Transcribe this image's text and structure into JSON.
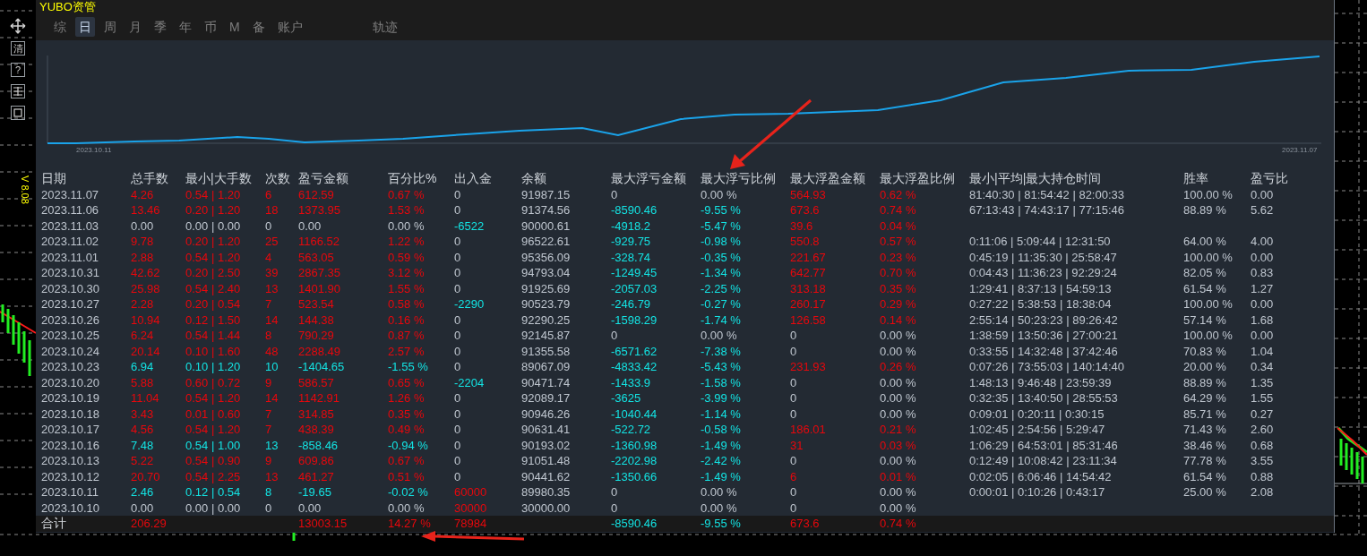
{
  "window": {
    "title": "YUBO资管"
  },
  "toolbar": [
    {
      "kind": "move"
    },
    {
      "kind": "label",
      "text": "清"
    },
    {
      "kind": "label",
      "text": "?"
    },
    {
      "kind": "grid"
    },
    {
      "kind": "frame"
    }
  ],
  "version": "V 8.08",
  "tab_groups": [
    {
      "tabs": [
        {
          "label": "综",
          "selected": false
        },
        {
          "label": "日",
          "selected": true
        },
        {
          "label": "周",
          "selected": false
        },
        {
          "label": "月",
          "selected": false
        },
        {
          "label": "季",
          "selected": false
        },
        {
          "label": "年",
          "selected": false
        },
        {
          "label": "币",
          "selected": false
        },
        {
          "label": "M",
          "selected": false
        },
        {
          "label": "备",
          "selected": false
        },
        {
          "label": "账户",
          "selected": false
        }
      ]
    },
    {
      "tabs": [
        {
          "label": "轨迹",
          "selected": false
        }
      ]
    }
  ],
  "chart": {
    "start_label": "2023.10.11",
    "end_label": "2023.11.07"
  },
  "table": {
    "columns": [
      "日期",
      "总手数",
      "最小|大手数",
      "次数",
      "盈亏金额",
      "百分比%",
      "出入金",
      "余额",
      "最大浮亏金额",
      "最大浮亏比例",
      "最大浮盈金额",
      "最大浮盈比例",
      "最小|平均|最大持仓时间",
      "胜率",
      "盈亏比"
    ],
    "rows": [
      {
        "date": "2023.11.07",
        "lots": {
          "text": "4.26",
          "color": "#e8070c"
        },
        "lot_range": {
          "text": "0.54 | 1.20",
          "color": "#e8070c"
        },
        "trades": {
          "text": "6",
          "color": "#e8070c"
        },
        "pnl": {
          "text": "612.59",
          "color": "#e8070c"
        },
        "percent": {
          "text": "0.67 %",
          "color": "#e8070c"
        },
        "flow": {
          "text": "0",
          "color": "#bfc6cf"
        },
        "balance": "91987.15",
        "max_float_loss": {
          "text": "0",
          "color": "#bfc6cf"
        },
        "max_float_loss_pct": {
          "text": "0.00 %",
          "color": "#bfc6cf"
        },
        "max_float_profit": {
          "text": "564.93",
          "color": "#e8070c"
        },
        "max_float_profit_pct": {
          "text": "0.62 %",
          "color": "#e8070c"
        },
        "hold_times": "81:40:30 | 81:54:42 | 82:00:33",
        "win_rate": "100.00 %",
        "pl_ratio": "0.00"
      },
      {
        "date": "2023.11.06",
        "lots": {
          "text": "13.46",
          "color": "#e8070c"
        },
        "lot_range": {
          "text": "0.20 | 1.20",
          "color": "#e8070c"
        },
        "trades": {
          "text": "18",
          "color": "#e8070c"
        },
        "pnl": {
          "text": "1373.95",
          "color": "#e8070c"
        },
        "percent": {
          "text": "1.53 %",
          "color": "#e8070c"
        },
        "flow": {
          "text": "0",
          "color": "#bfc6cf"
        },
        "balance": "91374.56",
        "max_float_loss": {
          "text": "-8590.46",
          "color": "#13e3e3"
        },
        "max_float_loss_pct": {
          "text": "-9.55 %",
          "color": "#13e3e3"
        },
        "max_float_profit": {
          "text": "673.6",
          "color": "#e8070c"
        },
        "max_float_profit_pct": {
          "text": "0.74 %",
          "color": "#e8070c"
        },
        "hold_times": "67:13:43 | 74:43:17 | 77:15:46",
        "win_rate": "88.89 %",
        "pl_ratio": "5.62"
      },
      {
        "date": "2023.11.03",
        "lots": {
          "text": "0.00",
          "color": "#bfc6cf"
        },
        "lot_range": {
          "text": "0.00 | 0.00",
          "color": "#bfc6cf"
        },
        "trades": {
          "text": "0",
          "color": "#bfc6cf"
        },
        "pnl": {
          "text": "0.00",
          "color": "#bfc6cf"
        },
        "percent": {
          "text": "0.00 %",
          "color": "#bfc6cf"
        },
        "flow": {
          "text": "-6522",
          "color": "#13e3e3"
        },
        "balance": "90000.61",
        "max_float_loss": {
          "text": "-4918.2",
          "color": "#13e3e3"
        },
        "max_float_loss_pct": {
          "text": "-5.47 %",
          "color": "#13e3e3"
        },
        "max_float_profit": {
          "text": "39.6",
          "color": "#e8070c"
        },
        "max_float_profit_pct": {
          "text": "0.04 %",
          "color": "#e8070c"
        }
      },
      {
        "date": "2023.11.02",
        "lots": {
          "text": "9.78",
          "color": "#e8070c"
        },
        "lot_range": {
          "text": "0.20 | 1.20",
          "color": "#e8070c"
        },
        "trades": {
          "text": "25",
          "color": "#e8070c"
        },
        "pnl": {
          "text": "1166.52",
          "color": "#e8070c"
        },
        "percent": {
          "text": "1.22 %",
          "color": "#e8070c"
        },
        "flow": {
          "text": "0",
          "color": "#bfc6cf"
        },
        "balance": "96522.61",
        "max_float_loss": {
          "text": "-929.75",
          "color": "#13e3e3"
        },
        "max_float_loss_pct": {
          "text": "-0.98 %",
          "color": "#13e3e3"
        },
        "max_float_profit": {
          "text": "550.8",
          "color": "#e8070c"
        },
        "max_float_profit_pct": {
          "text": "0.57 %",
          "color": "#e8070c"
        },
        "hold_times": "0:11:06 | 5:09:44 | 12:31:50",
        "win_rate": "64.00 %",
        "pl_ratio": "4.00"
      },
      {
        "date": "2023.11.01",
        "lots": {
          "text": "2.88",
          "color": "#e8070c"
        },
        "lot_range": {
          "text": "0.54 | 1.20",
          "color": "#e8070c"
        },
        "trades": {
          "text": "4",
          "color": "#e8070c"
        },
        "pnl": {
          "text": "563.05",
          "color": "#e8070c"
        },
        "percent": {
          "text": "0.59 %",
          "color": "#e8070c"
        },
        "flow": {
          "text": "0",
          "color": "#bfc6cf"
        },
        "balance": "95356.09",
        "max_float_loss": {
          "text": "-328.74",
          "color": "#13e3e3"
        },
        "max_float_loss_pct": {
          "text": "-0.35 %",
          "color": "#13e3e3"
        },
        "max_float_profit": {
          "text": "221.67",
          "color": "#e8070c"
        },
        "max_float_profit_pct": {
          "text": "0.23 %",
          "color": "#e8070c"
        },
        "hold_times": "0:45:19 | 11:35:30 | 25:58:47",
        "win_rate": "100.00 %",
        "pl_ratio": "0.00"
      },
      {
        "date": "2023.10.31",
        "lots": {
          "text": "42.62",
          "color": "#e8070c"
        },
        "lot_range": {
          "text": "0.20 | 2.50",
          "color": "#e8070c"
        },
        "trades": {
          "text": "39",
          "color": "#e8070c"
        },
        "pnl": {
          "text": "2867.35",
          "color": "#e8070c"
        },
        "percent": {
          "text": "3.12 %",
          "color": "#e8070c"
        },
        "flow": {
          "text": "0",
          "color": "#bfc6cf"
        },
        "balance": "94793.04",
        "max_float_loss": {
          "text": "-1249.45",
          "color": "#13e3e3"
        },
        "max_float_loss_pct": {
          "text": "-1.34 %",
          "color": "#13e3e3"
        },
        "max_float_profit": {
          "text": "642.77",
          "color": "#e8070c"
        },
        "max_float_profit_pct": {
          "text": "0.70 %",
          "color": "#e8070c"
        },
        "hold_times": "0:04:43 | 11:36:23 | 92:29:24",
        "win_rate": "82.05 %",
        "pl_ratio": "0.83"
      },
      {
        "date": "2023.10.30",
        "lots": {
          "text": "25.98",
          "color": "#e8070c"
        },
        "lot_range": {
          "text": "0.54 | 2.40",
          "color": "#e8070c"
        },
        "trades": {
          "text": "13",
          "color": "#e8070c"
        },
        "pnl": {
          "text": "1401.90",
          "color": "#e8070c"
        },
        "percent": {
          "text": "1.55 %",
          "color": "#e8070c"
        },
        "flow": {
          "text": "0",
          "color": "#bfc6cf"
        },
        "balance": "91925.69",
        "max_float_loss": {
          "text": "-2057.03",
          "color": "#13e3e3"
        },
        "max_float_loss_pct": {
          "text": "-2.25 %",
          "color": "#13e3e3"
        },
        "max_float_profit": {
          "text": "313.18",
          "color": "#e8070c"
        },
        "max_float_profit_pct": {
          "text": "0.35 %",
          "color": "#e8070c"
        },
        "hold_times": "1:29:41 | 8:37:13 | 54:59:13",
        "win_rate": "61.54 %",
        "pl_ratio": "1.27"
      },
      {
        "date": "2023.10.27",
        "lots": {
          "text": "2.28",
          "color": "#e8070c"
        },
        "lot_range": {
          "text": "0.20 | 0.54",
          "color": "#e8070c"
        },
        "trades": {
          "text": "7",
          "color": "#e8070c"
        },
        "pnl": {
          "text": "523.54",
          "color": "#e8070c"
        },
        "percent": {
          "text": "0.58 %",
          "color": "#e8070c"
        },
        "flow": {
          "text": "-2290",
          "color": "#13e3e3"
        },
        "balance": "90523.79",
        "max_float_loss": {
          "text": "-246.79",
          "color": "#13e3e3"
        },
        "max_float_loss_pct": {
          "text": "-0.27 %",
          "color": "#13e3e3"
        },
        "max_float_profit": {
          "text": "260.17",
          "color": "#e8070c"
        },
        "max_float_profit_pct": {
          "text": "0.29 %",
          "color": "#e8070c"
        },
        "hold_times": "0:27:22 | 5:38:53 | 18:38:04",
        "win_rate": "100.00 %",
        "pl_ratio": "0.00"
      },
      {
        "date": "2023.10.26",
        "lots": {
          "text": "10.94",
          "color": "#e8070c"
        },
        "lot_range": {
          "text": "0.12 | 1.50",
          "color": "#e8070c"
        },
        "trades": {
          "text": "14",
          "color": "#e8070c"
        },
        "pnl": {
          "text": "144.38",
          "color": "#e8070c"
        },
        "percent": {
          "text": "0.16 %",
          "color": "#e8070c"
        },
        "flow": {
          "text": "0",
          "color": "#bfc6cf"
        },
        "balance": "92290.25",
        "max_float_loss": {
          "text": "-1598.29",
          "color": "#13e3e3"
        },
        "max_float_loss_pct": {
          "text": "-1.74 %",
          "color": "#13e3e3"
        },
        "max_float_profit": {
          "text": "126.58",
          "color": "#e8070c"
        },
        "max_float_profit_pct": {
          "text": "0.14 %",
          "color": "#e8070c"
        },
        "hold_times": "2:55:14 | 50:23:23 | 89:26:42",
        "win_rate": "57.14 %",
        "pl_ratio": "1.68"
      },
      {
        "date": "2023.10.25",
        "lots": {
          "text": "6.24",
          "color": "#e8070c"
        },
        "lot_range": {
          "text": "0.54 | 1.44",
          "color": "#e8070c"
        },
        "trades": {
          "text": "8",
          "color": "#e8070c"
        },
        "pnl": {
          "text": "790.29",
          "color": "#e8070c"
        },
        "percent": {
          "text": "0.87 %",
          "color": "#e8070c"
        },
        "flow": {
          "text": "0",
          "color": "#bfc6cf"
        },
        "balance": "92145.87",
        "max_float_loss": {
          "text": "0",
          "color": "#bfc6cf"
        },
        "max_float_loss_pct": {
          "text": "0.00 %",
          "color": "#bfc6cf"
        },
        "max_float_profit": {
          "text": "0",
          "color": "#bfc6cf"
        },
        "max_float_profit_pct": {
          "text": "0.00 %",
          "color": "#bfc6cf"
        },
        "hold_times": "1:38:59 | 13:50:36 | 27:00:21",
        "win_rate": "100.00 %",
        "pl_ratio": "0.00"
      },
      {
        "date": "2023.10.24",
        "lots": {
          "text": "20.14",
          "color": "#e8070c"
        },
        "lot_range": {
          "text": "0.10 | 1.60",
          "color": "#e8070c"
        },
        "trades": {
          "text": "48",
          "color": "#e8070c"
        },
        "pnl": {
          "text": "2288.49",
          "color": "#e8070c"
        },
        "percent": {
          "text": "2.57 %",
          "color": "#e8070c"
        },
        "flow": {
          "text": "0",
          "color": "#bfc6cf"
        },
        "balance": "91355.58",
        "max_float_loss": {
          "text": "-6571.62",
          "color": "#13e3e3"
        },
        "max_float_loss_pct": {
          "text": "-7.38 %",
          "color": "#13e3e3"
        },
        "max_float_profit": {
          "text": "0",
          "color": "#bfc6cf"
        },
        "max_float_profit_pct": {
          "text": "0.00 %",
          "color": "#bfc6cf"
        },
        "hold_times": "0:33:55 | 14:32:48 | 37:42:46",
        "win_rate": "70.83 %",
        "pl_ratio": "1.04"
      },
      {
        "date": "2023.10.23",
        "lots": {
          "text": "6.94",
          "color": "#13e3e3"
        },
        "lot_range": {
          "text": "0.10 | 1.20",
          "color": "#13e3e3"
        },
        "trades": {
          "text": "10",
          "color": "#13e3e3"
        },
        "pnl": {
          "text": "-1404.65",
          "color": "#13e3e3"
        },
        "percent": {
          "text": "-1.55 %",
          "color": "#13e3e3"
        },
        "flow": {
          "text": "0",
          "color": "#bfc6cf"
        },
        "balance": "89067.09",
        "max_float_loss": {
          "text": "-4833.42",
          "color": "#13e3e3"
        },
        "max_float_loss_pct": {
          "text": "-5.43 %",
          "color": "#13e3e3"
        },
        "max_float_profit": {
          "text": "231.93",
          "color": "#e8070c"
        },
        "max_float_profit_pct": {
          "text": "0.26 %",
          "color": "#e8070c"
        },
        "hold_times": "0:07:26 | 73:55:03 | 140:14:40",
        "win_rate": "20.00 %",
        "pl_ratio": "0.34"
      },
      {
        "date": "2023.10.20",
        "lots": {
          "text": "5.88",
          "color": "#e8070c"
        },
        "lot_range": {
          "text": "0.60 | 0.72",
          "color": "#e8070c"
        },
        "trades": {
          "text": "9",
          "color": "#e8070c"
        },
        "pnl": {
          "text": "586.57",
          "color": "#e8070c"
        },
        "percent": {
          "text": "0.65 %",
          "color": "#e8070c"
        },
        "flow": {
          "text": "-2204",
          "color": "#13e3e3"
        },
        "balance": "90471.74",
        "max_float_loss": {
          "text": "-1433.9",
          "color": "#13e3e3"
        },
        "max_float_loss_pct": {
          "text": "-1.58 %",
          "color": "#13e3e3"
        },
        "max_float_profit": {
          "text": "0",
          "color": "#bfc6cf"
        },
        "max_float_profit_pct": {
          "text": "0.00 %",
          "color": "#bfc6cf"
        },
        "hold_times": "1:48:13 | 9:46:48 | 23:59:39",
        "win_rate": "88.89 %",
        "pl_ratio": "1.35"
      },
      {
        "date": "2023.10.19",
        "lots": {
          "text": "11.04",
          "color": "#e8070c"
        },
        "lot_range": {
          "text": "0.54 | 1.20",
          "color": "#e8070c"
        },
        "trades": {
          "text": "14",
          "color": "#e8070c"
        },
        "pnl": {
          "text": "1142.91",
          "color": "#e8070c"
        },
        "percent": {
          "text": "1.26 %",
          "color": "#e8070c"
        },
        "flow": {
          "text": "0",
          "color": "#bfc6cf"
        },
        "balance": "92089.17",
        "max_float_loss": {
          "text": "-3625",
          "color": "#13e3e3"
        },
        "max_float_loss_pct": {
          "text": "-3.99 %",
          "color": "#13e3e3"
        },
        "max_float_profit": {
          "text": "0",
          "color": "#bfc6cf"
        },
        "max_float_profit_pct": {
          "text": "0.00 %",
          "color": "#bfc6cf"
        },
        "hold_times": "0:32:35 | 13:40:50 | 28:55:53",
        "win_rate": "64.29 %",
        "pl_ratio": "1.55"
      },
      {
        "date": "2023.10.18",
        "lots": {
          "text": "3.43",
          "color": "#e8070c"
        },
        "lot_range": {
          "text": "0.01 | 0.60",
          "color": "#e8070c"
        },
        "trades": {
          "text": "7",
          "color": "#e8070c"
        },
        "pnl": {
          "text": "314.85",
          "color": "#e8070c"
        },
        "percent": {
          "text": "0.35 %",
          "color": "#e8070c"
        },
        "flow": {
          "text": "0",
          "color": "#bfc6cf"
        },
        "balance": "90946.26",
        "max_float_loss": {
          "text": "-1040.44",
          "color": "#13e3e3"
        },
        "max_float_loss_pct": {
          "text": "-1.14 %",
          "color": "#13e3e3"
        },
        "max_float_profit": {
          "text": "0",
          "color": "#bfc6cf"
        },
        "max_float_profit_pct": {
          "text": "0.00 %",
          "color": "#bfc6cf"
        },
        "hold_times": "0:09:01 | 0:20:11 | 0:30:15",
        "win_rate": "85.71 %",
        "pl_ratio": "0.27"
      },
      {
        "date": "2023.10.17",
        "lots": {
          "text": "4.56",
          "color": "#e8070c"
        },
        "lot_range": {
          "text": "0.54 | 1.20",
          "color": "#e8070c"
        },
        "trades": {
          "text": "7",
          "color": "#e8070c"
        },
        "pnl": {
          "text": "438.39",
          "color": "#e8070c"
        },
        "percent": {
          "text": "0.49 %",
          "color": "#e8070c"
        },
        "flow": {
          "text": "0",
          "color": "#bfc6cf"
        },
        "balance": "90631.41",
        "max_float_loss": {
          "text": "-522.72",
          "color": "#13e3e3"
        },
        "max_float_loss_pct": {
          "text": "-0.58 %",
          "color": "#13e3e3"
        },
        "max_float_profit": {
          "text": "186.01",
          "color": "#e8070c"
        },
        "max_float_profit_pct": {
          "text": "0.21 %",
          "color": "#e8070c"
        },
        "hold_times": "1:02:45 | 2:54:56 | 5:29:47",
        "win_rate": "71.43 %",
        "pl_ratio": "2.60"
      },
      {
        "date": "2023.10.16",
        "lots": {
          "text": "7.48",
          "color": "#13e3e3"
        },
        "lot_range": {
          "text": "0.54 | 1.00",
          "color": "#13e3e3"
        },
        "trades": {
          "text": "13",
          "color": "#13e3e3"
        },
        "pnl": {
          "text": "-858.46",
          "color": "#13e3e3"
        },
        "percent": {
          "text": "-0.94 %",
          "color": "#13e3e3"
        },
        "flow": {
          "text": "0",
          "color": "#bfc6cf"
        },
        "balance": "90193.02",
        "max_float_loss": {
          "text": "-1360.98",
          "color": "#13e3e3"
        },
        "max_float_loss_pct": {
          "text": "-1.49 %",
          "color": "#13e3e3"
        },
        "max_float_profit": {
          "text": "31",
          "color": "#e8070c"
        },
        "max_float_profit_pct": {
          "text": "0.03 %",
          "color": "#e8070c"
        },
        "hold_times": "1:06:29 | 64:53:01 | 85:31:46",
        "win_rate": "38.46 %",
        "pl_ratio": "0.68"
      },
      {
        "date": "2023.10.13",
        "lots": {
          "text": "5.22",
          "color": "#e8070c"
        },
        "lot_range": {
          "text": "0.54 | 0.90",
          "color": "#e8070c"
        },
        "trades": {
          "text": "9",
          "color": "#e8070c"
        },
        "pnl": {
          "text": "609.86",
          "color": "#e8070c"
        },
        "percent": {
          "text": "0.67 %",
          "color": "#e8070c"
        },
        "flow": {
          "text": "0",
          "color": "#bfc6cf"
        },
        "balance": "91051.48",
        "max_float_loss": {
          "text": "-2202.98",
          "color": "#13e3e3"
        },
        "max_float_loss_pct": {
          "text": "-2.42 %",
          "color": "#13e3e3"
        },
        "max_float_profit": {
          "text": "0",
          "color": "#bfc6cf"
        },
        "max_float_profit_pct": {
          "text": "0.00 %",
          "color": "#bfc6cf"
        },
        "hold_times": "0:12:49 | 10:08:42 | 23:11:34",
        "win_rate": "77.78 %",
        "pl_ratio": "3.55"
      },
      {
        "date": "2023.10.12",
        "lots": {
          "text": "20.70",
          "color": "#e8070c"
        },
        "lot_range": {
          "text": "0.54 | 2.25",
          "color": "#e8070c"
        },
        "trades": {
          "text": "13",
          "color": "#e8070c"
        },
        "pnl": {
          "text": "461.27",
          "color": "#e8070c"
        },
        "percent": {
          "text": "0.51 %",
          "color": "#e8070c"
        },
        "flow": {
          "text": "0",
          "color": "#bfc6cf"
        },
        "balance": "90441.62",
        "max_float_loss": {
          "text": "-1350.66",
          "color": "#13e3e3"
        },
        "max_float_loss_pct": {
          "text": "-1.49 %",
          "color": "#13e3e3"
        },
        "max_float_profit": {
          "text": "6",
          "color": "#e8070c"
        },
        "max_float_profit_pct": {
          "text": "0.01 %",
          "color": "#e8070c"
        },
        "hold_times": "0:02:05 | 6:06:46 | 14:54:42",
        "win_rate": "61.54 %",
        "pl_ratio": "0.88"
      },
      {
        "date": "2023.10.11",
        "lots": {
          "text": "2.46",
          "color": "#13e3e3"
        },
        "lot_range": {
          "text": "0.12 | 0.54",
          "color": "#13e3e3"
        },
        "trades": {
          "text": "8",
          "color": "#13e3e3"
        },
        "pnl": {
          "text": "-19.65",
          "color": "#13e3e3"
        },
        "percent": {
          "text": "-0.02 %",
          "color": "#13e3e3"
        },
        "flow": {
          "text": "60000",
          "color": "#e8070c"
        },
        "balance": "89980.35",
        "max_float_loss": {
          "text": "0",
          "color": "#bfc6cf"
        },
        "max_float_loss_pct": {
          "text": "0.00 %",
          "color": "#bfc6cf"
        },
        "max_float_profit": {
          "text": "0",
          "color": "#bfc6cf"
        },
        "max_float_profit_pct": {
          "text": "0.00 %",
          "color": "#bfc6cf"
        },
        "hold_times": "0:00:01 | 0:10:26 | 0:43:17",
        "win_rate": "25.00 %",
        "pl_ratio": "2.08"
      },
      {
        "date": "2023.10.10",
        "lots": {
          "text": "0.00",
          "color": "#bfc6cf"
        },
        "lot_range": {
          "text": "0.00 | 0.00",
          "color": "#bfc6cf"
        },
        "trades": {
          "text": "0",
          "color": "#bfc6cf"
        },
        "pnl": {
          "text": "0.00",
          "color": "#bfc6cf"
        },
        "percent": {
          "text": "0.00 %",
          "color": "#bfc6cf"
        },
        "flow": {
          "text": "30000",
          "color": "#e8070c"
        },
        "balance": "30000.00",
        "max_float_loss": {
          "text": "0",
          "color": "#bfc6cf"
        },
        "max_float_loss_pct": {
          "text": "0.00 %",
          "color": "#bfc6cf"
        },
        "max_float_profit": {
          "text": "0",
          "color": "#bfc6cf"
        },
        "max_float_profit_pct": {
          "text": "0.00 %",
          "color": "#bfc6cf"
        }
      }
    ],
    "total": {
      "date": "合计",
      "lots": {
        "text": "206.29",
        "color": "#e8070c"
      },
      "pnl": {
        "text": "13003.15",
        "color": "#e8070c"
      },
      "percent": {
        "text": "14.27 %",
        "color": "#e8070c"
      },
      "flow": {
        "text": "78984",
        "color": "#e8070c"
      },
      "max_float_loss": {
        "text": "-8590.46",
        "color": "#13e3e3"
      },
      "max_float_loss_pct": {
        "text": "-9.55 %",
        "color": "#13e3e3"
      },
      "max_float_profit": {
        "text": "673.6",
        "color": "#e8070c"
      },
      "max_float_profit_pct": {
        "text": "0.74 %",
        "color": "#e8070c"
      }
    }
  }
}
